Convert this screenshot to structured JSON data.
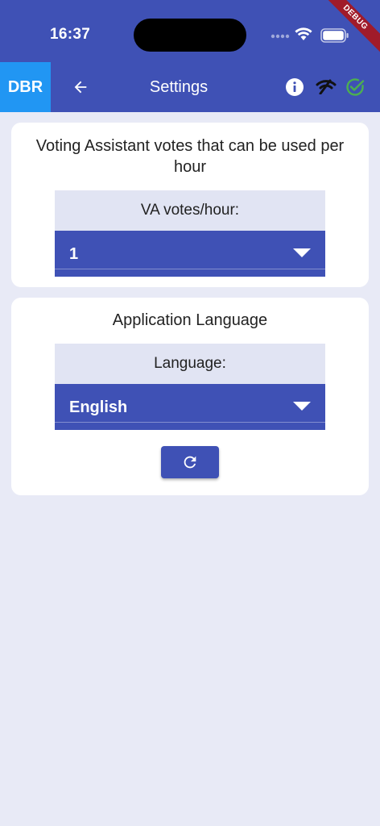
{
  "status_bar": {
    "time": "16:37",
    "debug_label": "DEBUG"
  },
  "app_bar": {
    "logo_text": "DBR",
    "title": "Settings",
    "icons": {
      "back": "arrow-left-icon",
      "info": "info-icon",
      "network": "network-icon",
      "status": "check-circle-icon"
    }
  },
  "votes_section": {
    "title": "Voting Assistant votes that can be used per hour",
    "dropdown_label": "VA votes/hour:",
    "selected_value": "1"
  },
  "language_section": {
    "title": "Application Language",
    "dropdown_label": "Language:",
    "selected_value": "English",
    "refresh_icon": "refresh-icon"
  },
  "colors": {
    "primary": "#3f51b5",
    "logo_background": "#2196f3",
    "page_background": "#e8eaf6",
    "label_background": "#e1e4f3",
    "success": "#4caf50",
    "debug_banner": "#a01b2a"
  }
}
